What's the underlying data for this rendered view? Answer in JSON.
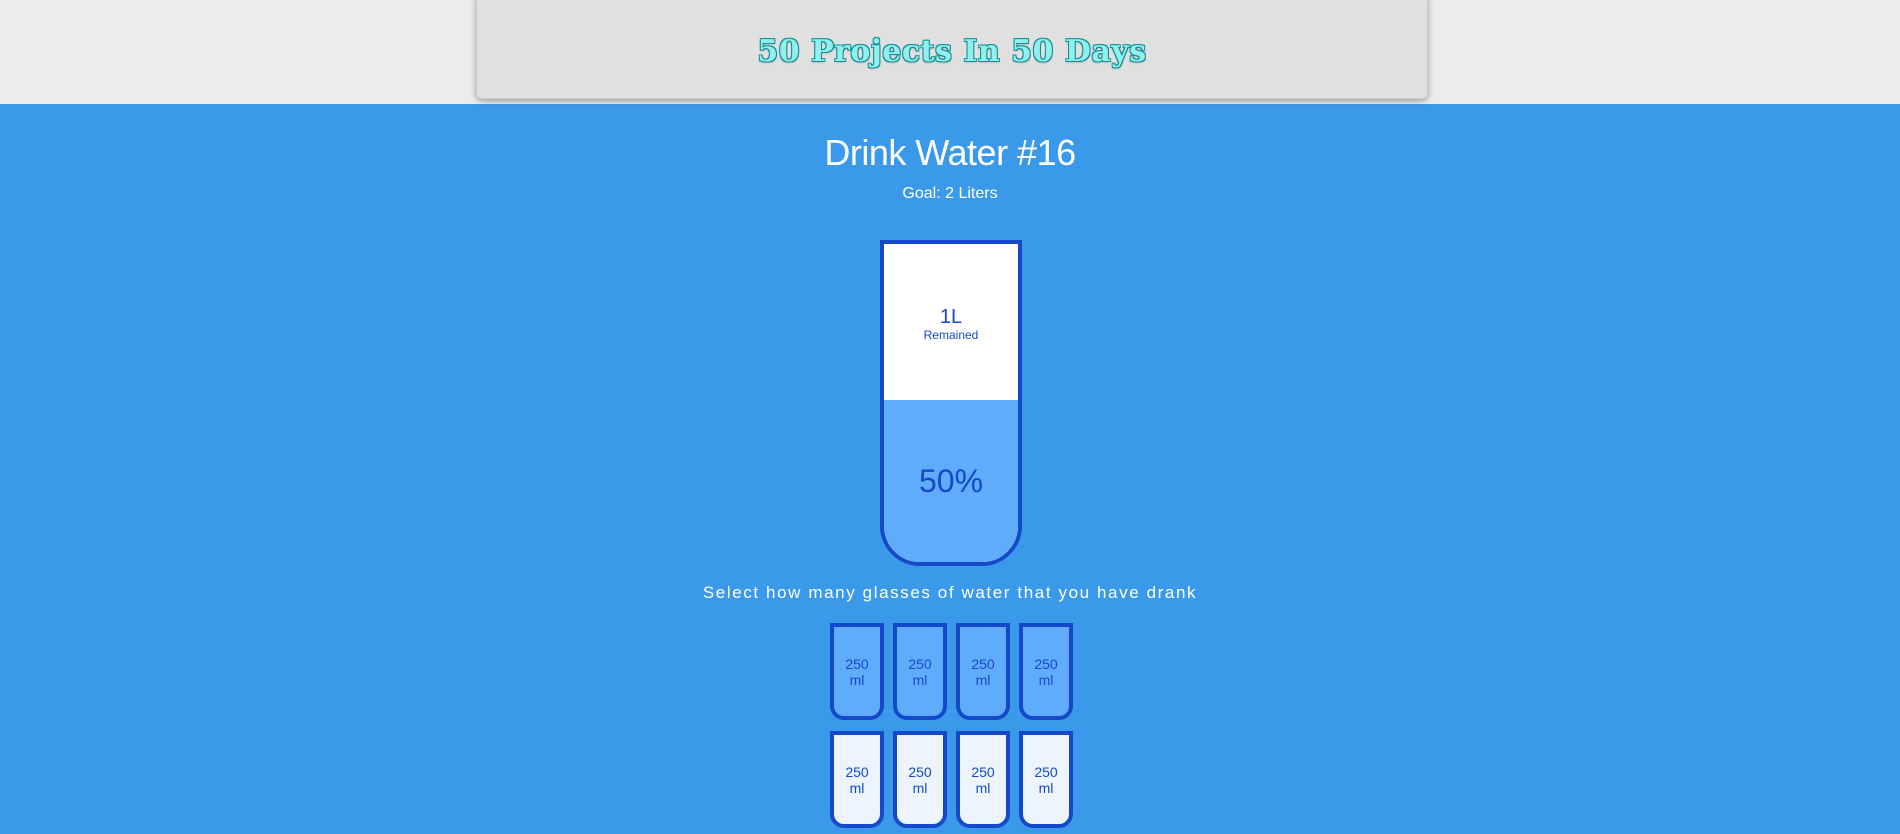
{
  "header": {
    "title": "50 Projects In 50 Days"
  },
  "main": {
    "title": "Drink Water #16",
    "goal": "Goal: 2 Liters",
    "instruction": "Select how many glasses of water that you have drank"
  },
  "big_cup": {
    "remained_liters": "1L",
    "remained_label": "Remained",
    "percentage_text": "50%",
    "fill_fraction": 0.5
  },
  "small_cups": [
    {
      "label": "250 ml",
      "full": true
    },
    {
      "label": "250 ml",
      "full": true
    },
    {
      "label": "250 ml",
      "full": true
    },
    {
      "label": "250 ml",
      "full": true
    },
    {
      "label": "250 ml",
      "full": false
    },
    {
      "label": "250 ml",
      "full": false
    },
    {
      "label": "250 ml",
      "full": false
    },
    {
      "label": "250 ml",
      "full": false
    }
  ],
  "colors": {
    "page_background": "#3a9ae9",
    "cup_border": "#1549c9",
    "cup_fill": "#60acfc",
    "cup_empty": "#edf4fd"
  }
}
